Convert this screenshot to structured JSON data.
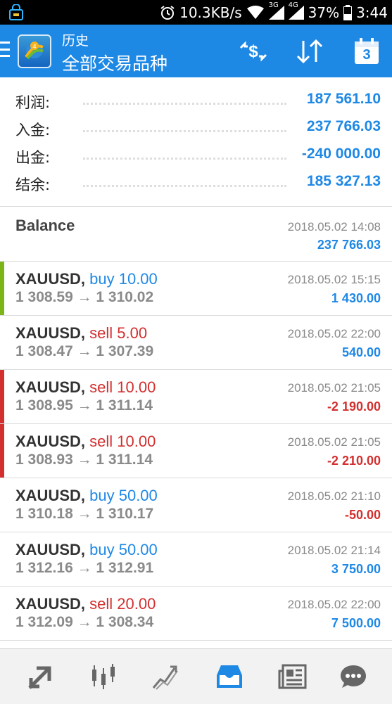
{
  "status_bar": {
    "network_speed": "10.3KB/s",
    "net_3g": "3G",
    "net_4g": "4G",
    "battery": "37%",
    "time": "3:44"
  },
  "header": {
    "title": "历史",
    "subtitle": "全部交易品种",
    "calendar_day": "3",
    "colors": {
      "app_bar": "#1e88e5"
    }
  },
  "summary": [
    {
      "label": "利润:",
      "value": "187 561.10"
    },
    {
      "label": "入金:",
      "value": "237 766.03"
    },
    {
      "label": "出金:",
      "value": "-240 000.00"
    },
    {
      "label": "结余:",
      "value": "185 327.13"
    }
  ],
  "balance_row": {
    "title": "Balance",
    "date": "2018.05.02 14:08",
    "amount": "237 766.03"
  },
  "trades": [
    {
      "symbol": "XAUUSD,",
      "side": "buy 10.00",
      "type": "buy",
      "prices": "1 308.59 → 1 310.02",
      "date": "2018.05.02 15:15",
      "profit": "1 430.00",
      "profit_sign": "pos",
      "marker": "#7cb518"
    },
    {
      "symbol": "XAUUSD,",
      "side": "sell 5.00",
      "type": "sell",
      "prices": "1 308.47 → 1 307.39",
      "date": "2018.05.02 22:00",
      "profit": "540.00",
      "profit_sign": "pos",
      "marker": ""
    },
    {
      "symbol": "XAUUSD,",
      "side": "sell 10.00",
      "type": "sell",
      "prices": "1 308.95 → 1 311.14",
      "date": "2018.05.02 21:05",
      "profit": "-2 190.00",
      "profit_sign": "neg",
      "marker": "#d32f2f"
    },
    {
      "symbol": "XAUUSD,",
      "side": "sell 10.00",
      "type": "sell",
      "prices": "1 308.93 → 1 311.14",
      "date": "2018.05.02 21:05",
      "profit": "-2 210.00",
      "profit_sign": "neg",
      "marker": "#d32f2f"
    },
    {
      "symbol": "XAUUSD,",
      "side": "buy 50.00",
      "type": "buy",
      "prices": "1 310.18 → 1 310.17",
      "date": "2018.05.02 21:10",
      "profit": "-50.00",
      "profit_sign": "neg",
      "marker": ""
    },
    {
      "symbol": "XAUUSD,",
      "side": "buy 50.00",
      "type": "buy",
      "prices": "1 312.16 → 1 312.91",
      "date": "2018.05.02 21:14",
      "profit": "3 750.00",
      "profit_sign": "pos",
      "marker": ""
    },
    {
      "symbol": "XAUUSD,",
      "side": "sell 20.00",
      "type": "sell",
      "prices": "1 312.09 → 1 308.34",
      "date": "2018.05.02 22:00",
      "profit": "7 500.00",
      "profit_sign": "pos",
      "marker": ""
    }
  ],
  "bottom_nav": [
    {
      "icon": "quotes-icon",
      "active": false
    },
    {
      "icon": "chart-candles-icon",
      "active": false
    },
    {
      "icon": "trade-icon",
      "active": false
    },
    {
      "icon": "history-inbox-icon",
      "active": true
    },
    {
      "icon": "news-icon",
      "active": false
    },
    {
      "icon": "chat-icon",
      "active": false
    }
  ]
}
